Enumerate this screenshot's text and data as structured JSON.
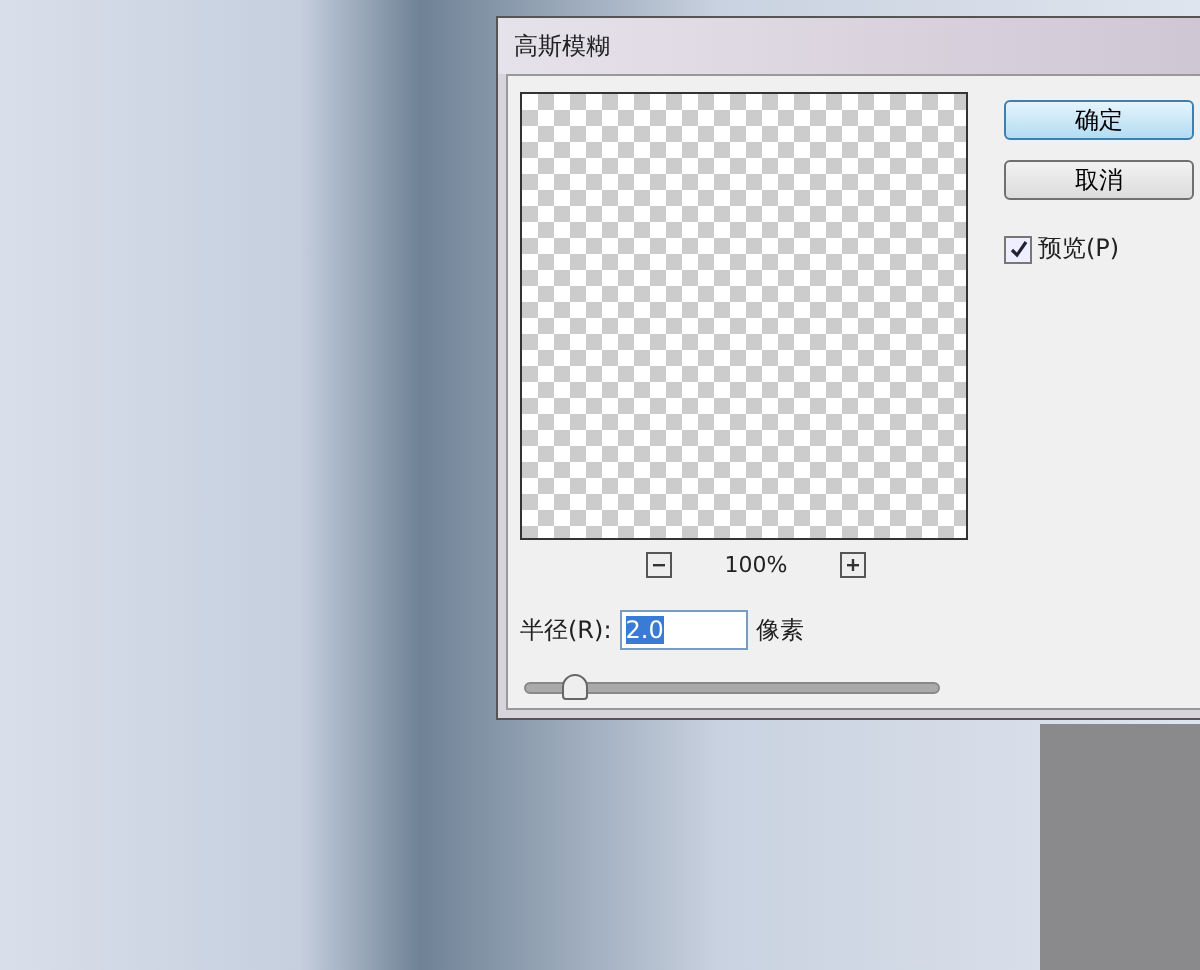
{
  "dialog": {
    "title": "高斯模糊",
    "preview": {
      "zoom": "100%"
    },
    "radius": {
      "label": "半径(R):",
      "value": "2.0",
      "unit": "像素",
      "level": 0.11
    },
    "buttons": [
      {
        "label": "确定",
        "default": true
      },
      {
        "label": "取消",
        "default": false
      }
    ],
    "preview_option": {
      "label": "预览(P)",
      "checked": true
    }
  }
}
